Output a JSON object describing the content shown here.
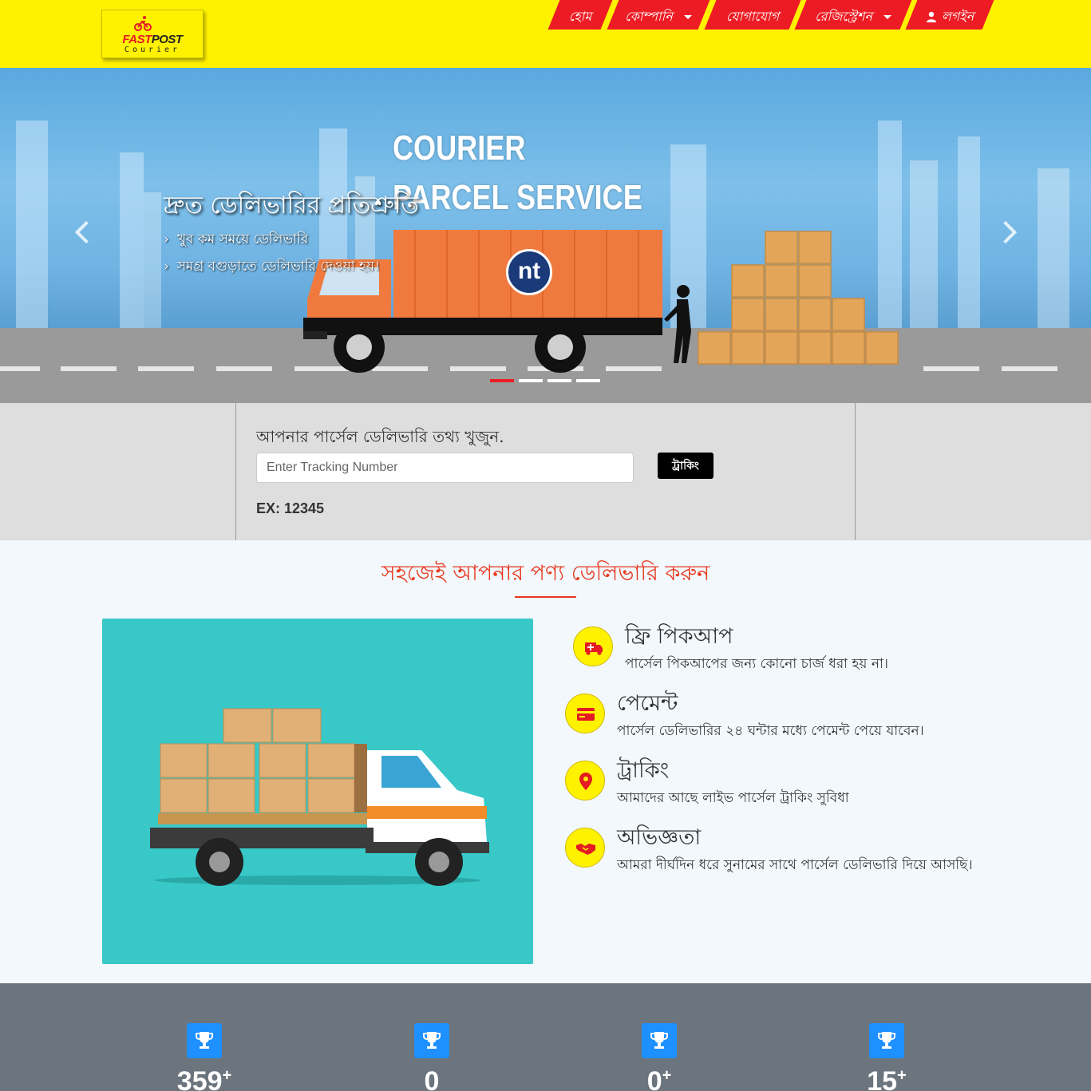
{
  "brand": {
    "name_part1": "FAST",
    "name_part2": "POST",
    "tagline": "Courier"
  },
  "nav": {
    "items": [
      {
        "label": "হোম"
      },
      {
        "label": "কোম্পানি"
      },
      {
        "label": "যোগাযোগ"
      },
      {
        "label": "রেজিস্ট্রেশন"
      },
      {
        "label": "লগইন"
      }
    ]
  },
  "hero": {
    "heading": "দ্রুত ডেলিভারির প্রতিশ্রুতি",
    "bullets": [
      "খুব কম সময়ে ডেলিভারি",
      "সমগ্র বগুড়াতে ডেলিভারি দেওয়া হয়।"
    ],
    "image_text_line1": "COURIER",
    "image_text_line2": "PARCEL SERVICE",
    "truck_logo": "nt",
    "active_slide": 1,
    "slide_count": 4
  },
  "tracking": {
    "title": "আপনার পার্সেল ডেলিভারি তথ্য খুজুন.",
    "placeholder": "Enter Tracking Number",
    "button_label": "ট্রাকিং",
    "example": "EX: 12345"
  },
  "features": {
    "title": "সহজেই আপনার পণ্য ডেলিভারি করুন",
    "items": [
      {
        "icon": "ambulance-icon",
        "title": "ফ্রি পিকআপ",
        "desc": "পার্সেল পিকআপের জন্য কোনো চার্জ ধরা হয় না।"
      },
      {
        "icon": "credit-card-icon",
        "title": "পেমেন্ট",
        "desc": "পার্সেল ডেলিভারির ২৪ ঘন্টার মধ্যে পেমেন্ট পেয়ে যাবেন।"
      },
      {
        "icon": "map-marker-icon",
        "title": "ট্রাকিং",
        "desc": "আমাদের আছে লাইভ পার্সেল ট্রাকিং সুবিধা"
      },
      {
        "icon": "handshake-icon",
        "title": "অভিজ্ঞতা",
        "desc": "আমরা দীর্ঘদিন ধরে সুনামের সাথে পার্সেল ডেলিভারি দিয়ে আসছি।"
      }
    ]
  },
  "stats": [
    {
      "value": "359",
      "plus": "+"
    },
    {
      "value": "0",
      "plus": ""
    },
    {
      "value": "0",
      "plus": "+"
    },
    {
      "value": "15",
      "plus": "+"
    }
  ],
  "colors": {
    "header_bg": "#fff200",
    "nav_bg": "#ed1c24",
    "accent": "#e8381f",
    "stats_bg": "#6c757d",
    "stat_icon_bg": "#1e90ff"
  }
}
